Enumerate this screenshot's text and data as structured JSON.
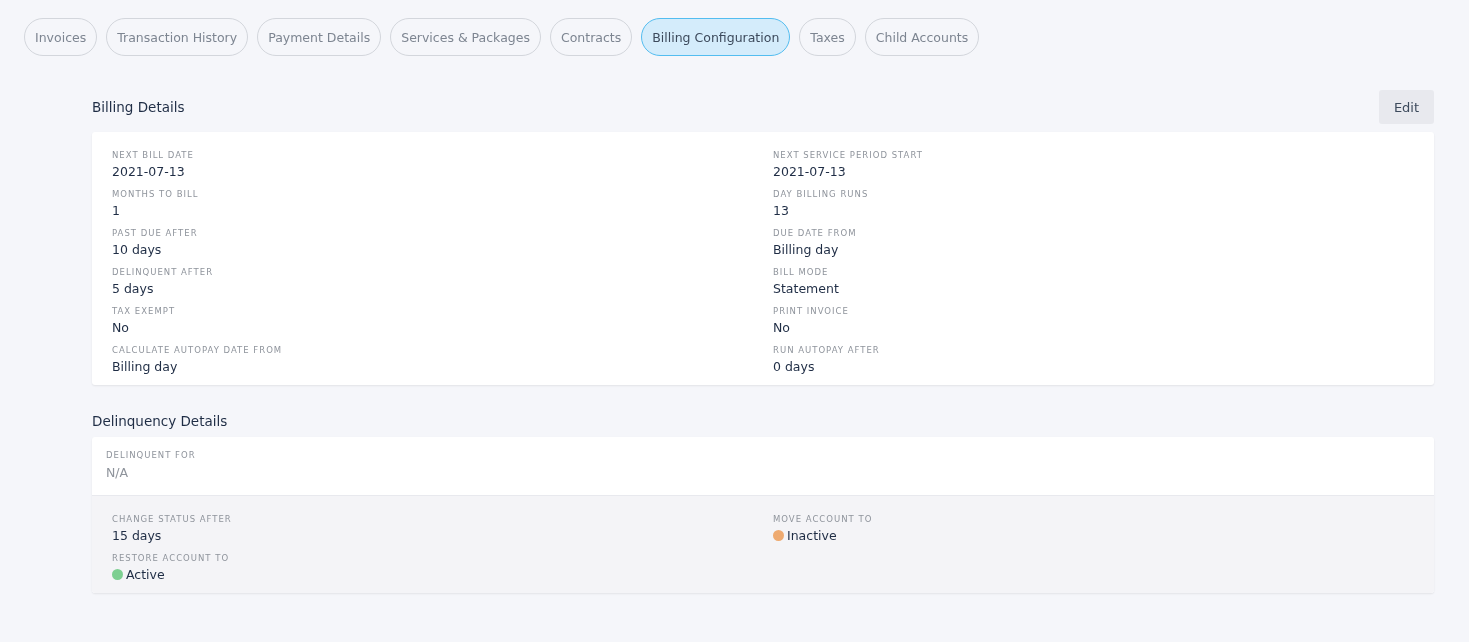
{
  "tabs": [
    {
      "label": "Invoices",
      "selected": false
    },
    {
      "label": "Transaction History",
      "selected": false
    },
    {
      "label": "Payment Details",
      "selected": false
    },
    {
      "label": "Services & Packages",
      "selected": false
    },
    {
      "label": "Contracts",
      "selected": false
    },
    {
      "label": "Billing Configuration",
      "selected": true
    },
    {
      "label": "Taxes",
      "selected": false
    },
    {
      "label": "Child Accounts",
      "selected": false
    }
  ],
  "billing_details": {
    "title": "Billing Details",
    "edit_button": "Edit",
    "fields": [
      {
        "label": "NEXT BILL DATE",
        "value": "2021-07-13"
      },
      {
        "label": "NEXT SERVICE PERIOD START",
        "value": "2021-07-13"
      },
      {
        "label": "MONTHS TO BILL",
        "value": "1"
      },
      {
        "label": "DAY BILLING RUNS",
        "value": "13"
      },
      {
        "label": "PAST DUE AFTER",
        "value": "10 days"
      },
      {
        "label": "DUE DATE FROM",
        "value": "Billing day"
      },
      {
        "label": "DELINQUENT AFTER",
        "value": "5 days"
      },
      {
        "label": "BILL MODE",
        "value": "Statement"
      },
      {
        "label": "TAX EXEMPT",
        "value": "No"
      },
      {
        "label": "PRINT INVOICE",
        "value": "No"
      },
      {
        "label": "CALCULATE AUTOPAY DATE FROM",
        "value": "Billing day"
      },
      {
        "label": "RUN AUTOPAY AFTER",
        "value": "0 days"
      }
    ]
  },
  "delinquency_details": {
    "title": "Delinquency Details",
    "delinquent_for": {
      "label": "DELINQUENT FOR",
      "value": "N/A"
    },
    "fields": [
      {
        "kind": "text",
        "label": "CHANGE STATUS AFTER",
        "value": "15 days"
      },
      {
        "kind": "status",
        "label": "MOVE ACCOUNT TO",
        "value": "Inactive",
        "color": "#eeaa70"
      },
      {
        "kind": "status",
        "label": "RESTORE ACCOUNT TO",
        "value": "Active",
        "color": "#7ccf91"
      }
    ]
  }
}
